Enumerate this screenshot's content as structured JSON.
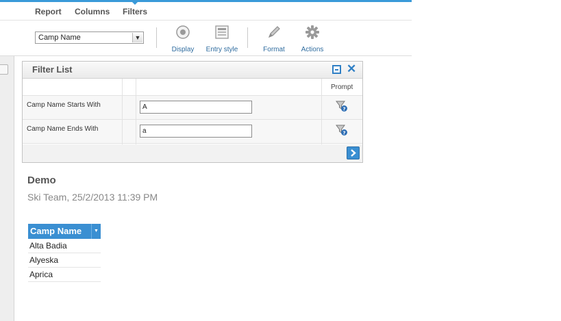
{
  "menu": {
    "items": [
      "Report",
      "Columns",
      "Filters"
    ]
  },
  "toolbar": {
    "column_select_value": "Camp Name",
    "buttons": {
      "display": "Display",
      "entry_style": "Entry style",
      "format": "Format",
      "actions": "Actions"
    }
  },
  "filter_panel": {
    "title": "Filter List",
    "prompt_header": "Prompt",
    "rows": [
      {
        "label": "Camp Name Starts With",
        "value": "A"
      },
      {
        "label": "Camp Name Ends With",
        "value": "a"
      }
    ]
  },
  "report": {
    "title": "Demo",
    "subtitle": "Ski Team, 25/2/2013 11:39 PM",
    "table": {
      "column": "Camp Name",
      "rows": [
        "Alta Badia",
        "Alyeska",
        "Aprica"
      ]
    }
  },
  "colors": {
    "accent": "#3a8fd2",
    "topbar": "#3a9ad9",
    "link": "#2f6c9f"
  },
  "icons": [
    "eye-icon",
    "entry-style-icon",
    "pencil-icon",
    "gear-icon",
    "minimize-icon",
    "close-icon",
    "prompt-filter-icon",
    "arrow-right-icon",
    "dropdown-arrow-icon"
  ]
}
